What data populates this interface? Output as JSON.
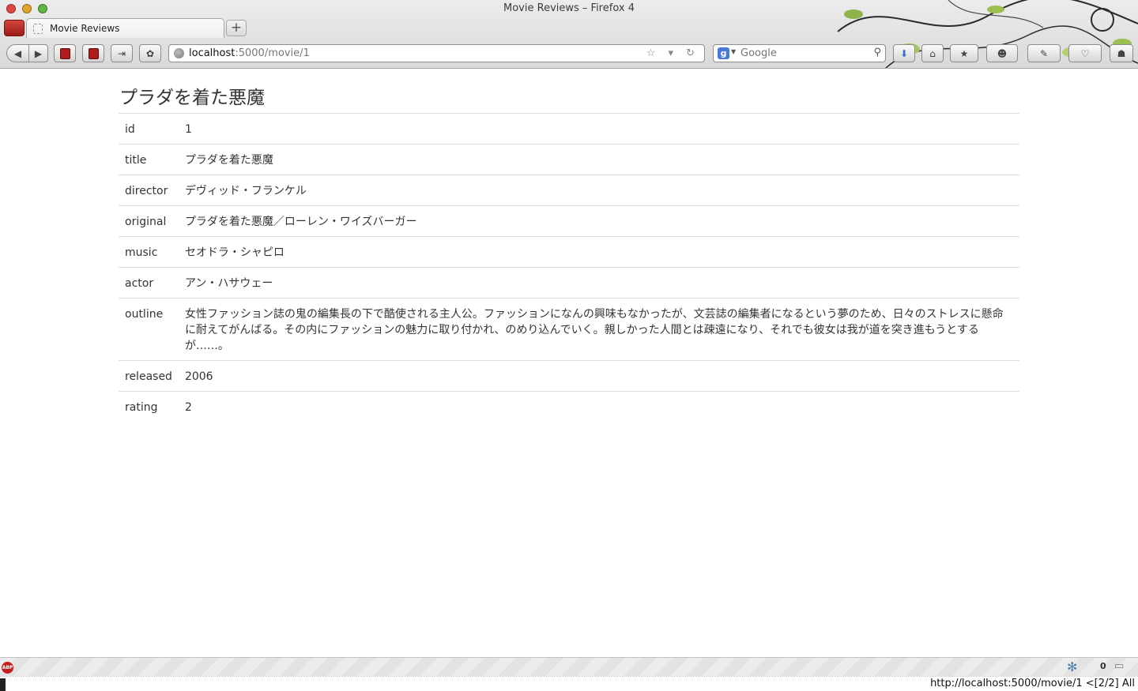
{
  "window": {
    "title": "Movie Reviews – Firefox 4",
    "tab_label": "Movie Reviews",
    "new_tab": "+"
  },
  "navbar": {
    "back": "◀",
    "forward": "▶",
    "url_host": "localhost",
    "url_rest": ":5000/movie/1",
    "url_icons": "☆ ▾ ↻",
    "search_engine": "g",
    "search_placeholder": "Google",
    "search_go": "⚲"
  },
  "movie": {
    "heading": "プラダを着た悪魔",
    "fields": [
      {
        "key": "id",
        "value": "1"
      },
      {
        "key": "title",
        "value": "プラダを着た悪魔"
      },
      {
        "key": "director",
        "value": "デヴィッド・フランケル"
      },
      {
        "key": "original",
        "value": "プラダを着た悪魔／ローレン・ワイズバーガー"
      },
      {
        "key": "music",
        "value": "セオドラ・シャピロ"
      },
      {
        "key": "actor",
        "value": "アン・ハサウェー"
      },
      {
        "key": "outline",
        "value": "女性ファッション誌の鬼の編集長の下で酷使される主人公。ファッションになんの興味もなかったが、文芸誌の編集者になるという夢のため、日々のストレスに懸命に耐えてがんばる。その内にファッションの魅力に取り付かれ、のめり込んでいく。親しかった人間とは疎遠になり、それでも彼女は我が道を突き進もうとするが……。"
      },
      {
        "key": "released",
        "value": "2006"
      },
      {
        "key": "rating",
        "value": "2"
      }
    ]
  },
  "addon_bar": {
    "abp_label": "ABP",
    "gear": "✻",
    "count": "0",
    "bubble": "▭"
  },
  "status": {
    "text": "http://localhost:5000/movie/1 <[2/2] All"
  }
}
